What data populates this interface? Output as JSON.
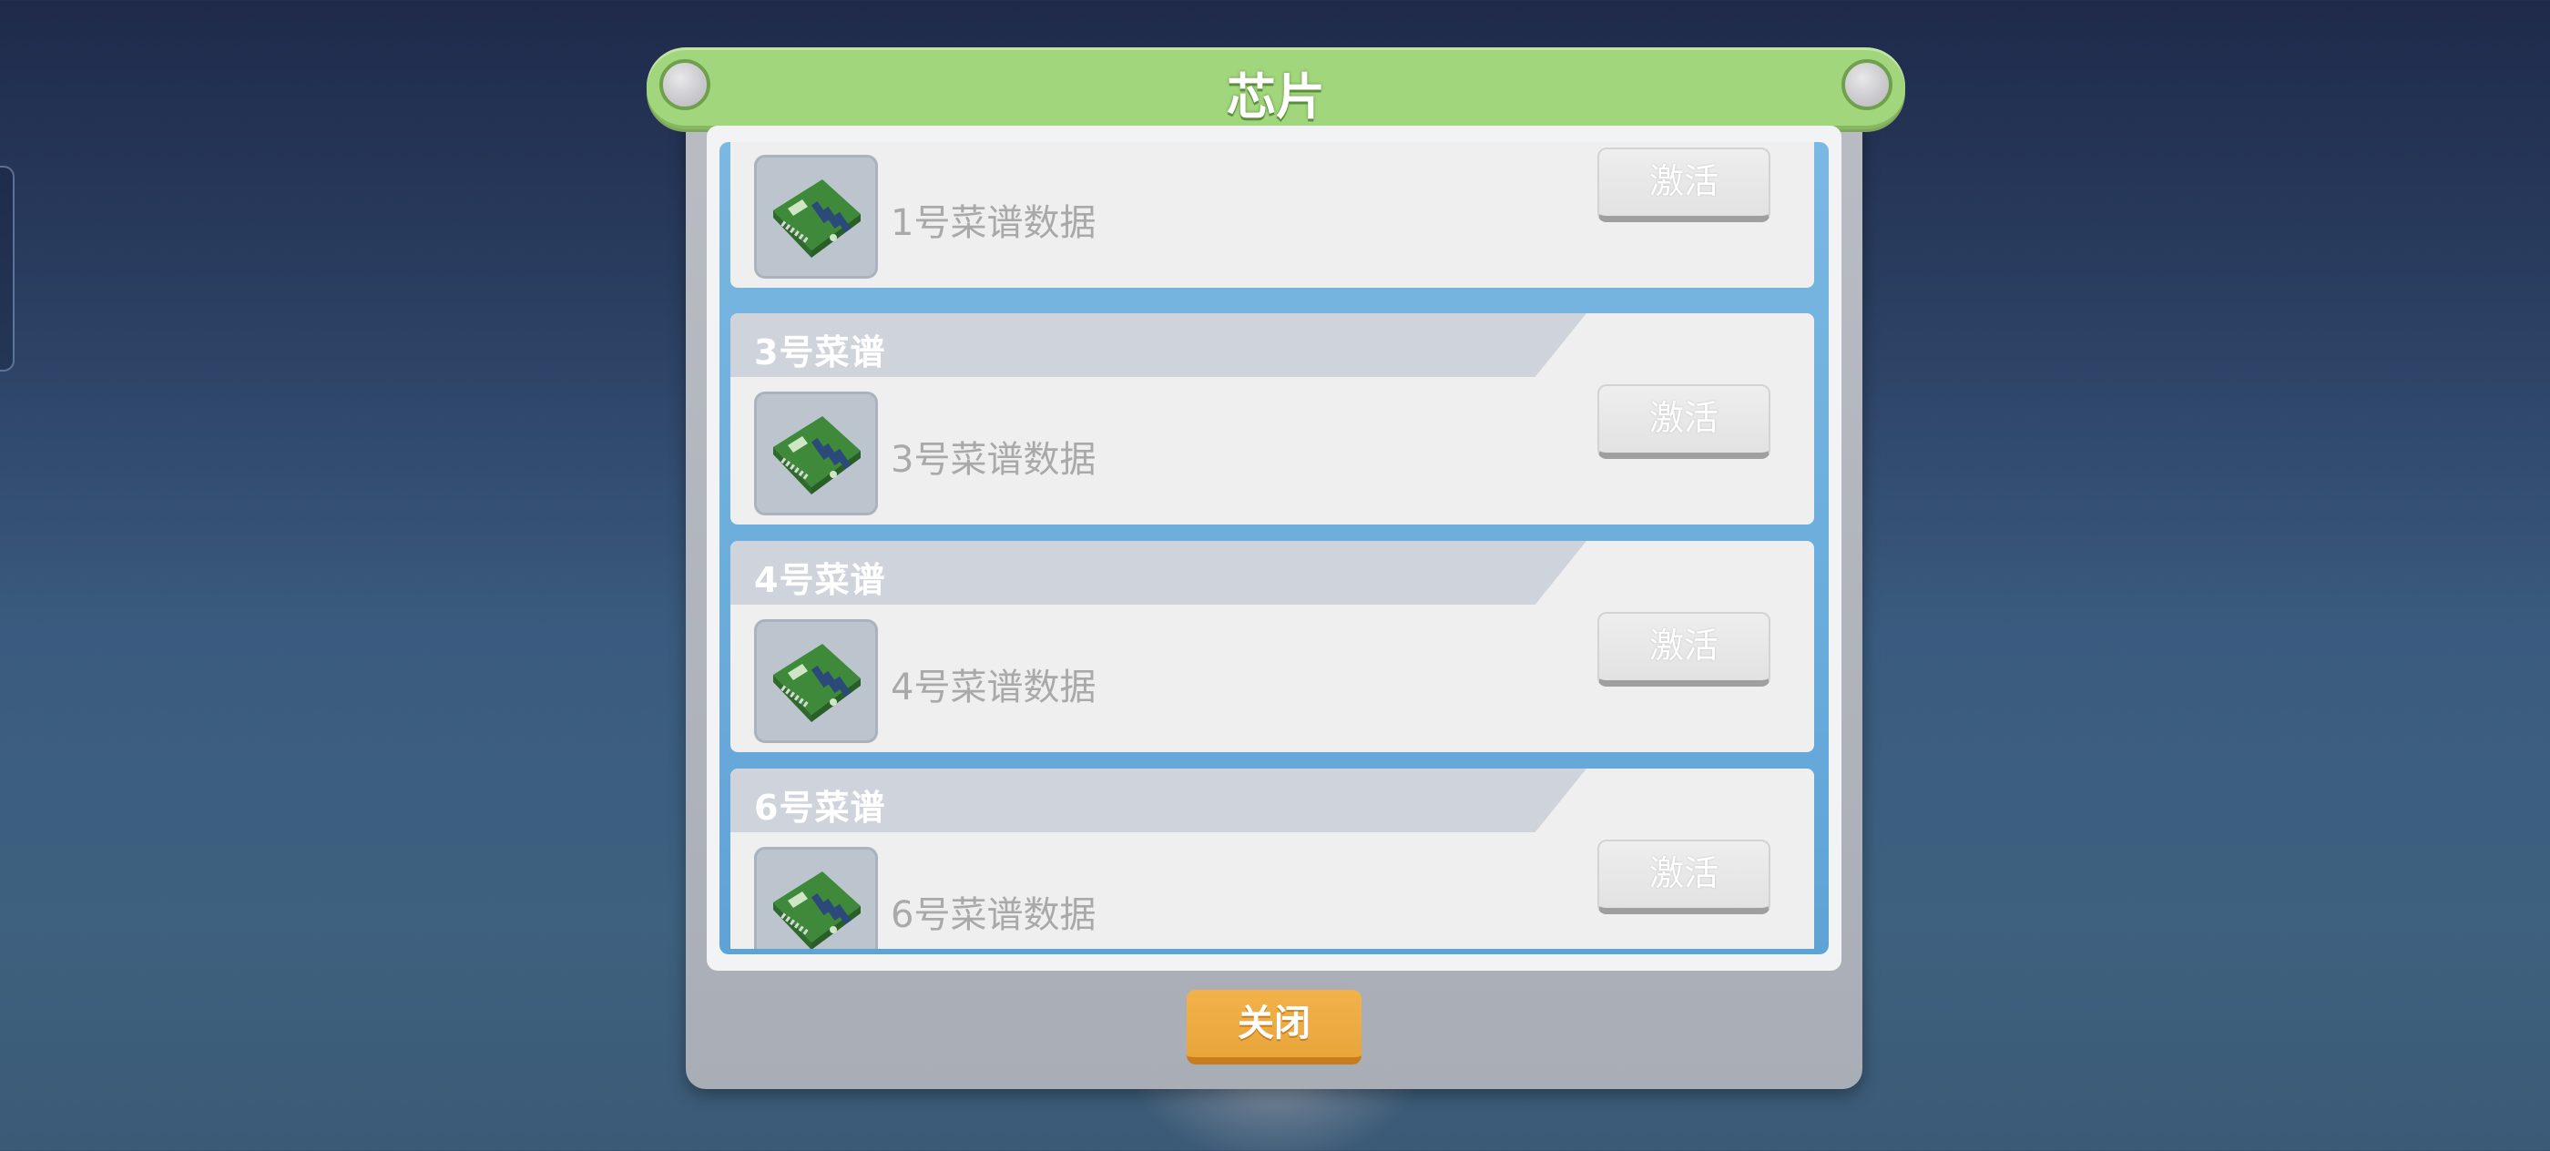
{
  "dialog": {
    "title": "芯片",
    "close_label": "关闭"
  },
  "chips": [
    {
      "title": "",
      "description": "1号菜谱数据",
      "action_label": "激活",
      "icon": "chip-board-icon"
    },
    {
      "title": "3号菜谱",
      "description": "3号菜谱数据",
      "action_label": "激活",
      "icon": "chip-board-icon"
    },
    {
      "title": "4号菜谱",
      "description": "4号菜谱数据",
      "action_label": "激活",
      "icon": "chip-board-icon"
    },
    {
      "title": "6号菜谱",
      "description": "6号菜谱数据",
      "action_label": "激活",
      "icon": "chip-board-icon"
    }
  ],
  "colors": {
    "title_bar": "#a2d67c",
    "close_button": "#f2b24a",
    "list_frame": "#6aaedc"
  }
}
